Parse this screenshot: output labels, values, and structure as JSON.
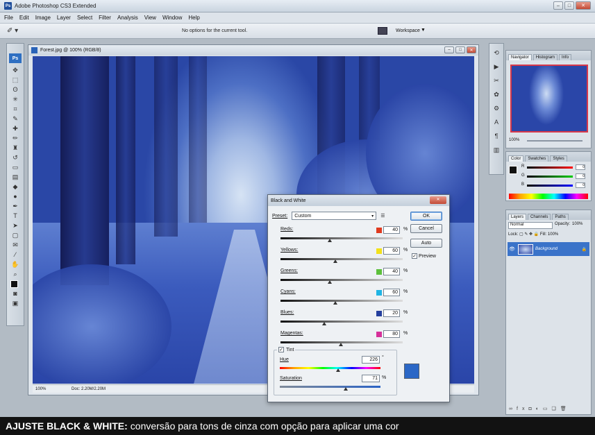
{
  "window": {
    "title": "Adobe Photoshop CS3 Extended",
    "app_icon": "Ps"
  },
  "menubar": [
    "File",
    "Edit",
    "Image",
    "Layer",
    "Select",
    "Filter",
    "Analysis",
    "View",
    "Window",
    "Help"
  ],
  "options_bar": {
    "message": "No options for the current tool.",
    "workspace_label": "Workspace"
  },
  "toolbox": {
    "logo": "Ps"
  },
  "document": {
    "title": "Forest.jpg @ 100% (RGB/8)",
    "zoom": "100%",
    "doc_info": "Doc: 2.20M/2.20M"
  },
  "dialog": {
    "title": "Black and White",
    "preset_label": "Preset:",
    "preset_value": "Custom",
    "sliders": [
      {
        "label": "Reds:",
        "value": "40",
        "unit": "%",
        "color": "#e03a1e",
        "level": 0.4
      },
      {
        "label": "Yellows:",
        "value": "60",
        "unit": "%",
        "color": "#f2e11a",
        "level": 0.45
      },
      {
        "label": "Greens:",
        "value": "40",
        "unit": "%",
        "color": "#5dc03c",
        "level": 0.4
      },
      {
        "label": "Cyans:",
        "value": "60",
        "unit": "%",
        "color": "#1fb4e4",
        "level": 0.45
      },
      {
        "label": "Blues:",
        "value": "20",
        "unit": "%",
        "color": "#243f9e",
        "level": 0.35
      },
      {
        "label": "Magentas:",
        "value": "80",
        "unit": "%",
        "color": "#d6309a",
        "level": 0.5
      }
    ],
    "buttons": {
      "ok": "OK",
      "cancel": "Cancel",
      "auto": "Auto"
    },
    "preview_label": "Preview",
    "tint": {
      "label": "Tint",
      "hue_label": "Hue",
      "hue_value": "226",
      "hue_unit": "°",
      "saturation_label": "Saturation",
      "saturation_value": "71",
      "saturation_unit": "%",
      "hue_level": 0.63,
      "saturation_level": 0.71,
      "swatch_color": "#2b67c6"
    }
  },
  "panels": {
    "navigator_tabs": [
      "Navigator",
      "Histogram",
      "Info"
    ],
    "navigator_zoom": "100%",
    "color_tabs": [
      "Color",
      "Swatches",
      "Styles"
    ],
    "color_channels": [
      {
        "name": "R",
        "value": "0"
      },
      {
        "name": "G",
        "value": "0"
      },
      {
        "name": "B",
        "value": "0"
      }
    ],
    "layers_tabs": [
      "Layers",
      "Channels",
      "Paths"
    ],
    "blend_mode": "Normal",
    "opacity_label": "Opacity:",
    "opacity_value": "100%",
    "lock_label": "Lock:",
    "fill_label": "Fill:",
    "fill_value": "100%",
    "layer_name": "Background"
  },
  "caption": {
    "bold": "AJUSTE BLACK & WHITE:",
    "text": "conversão para tons de cinza com opção para aplicar uma cor"
  }
}
